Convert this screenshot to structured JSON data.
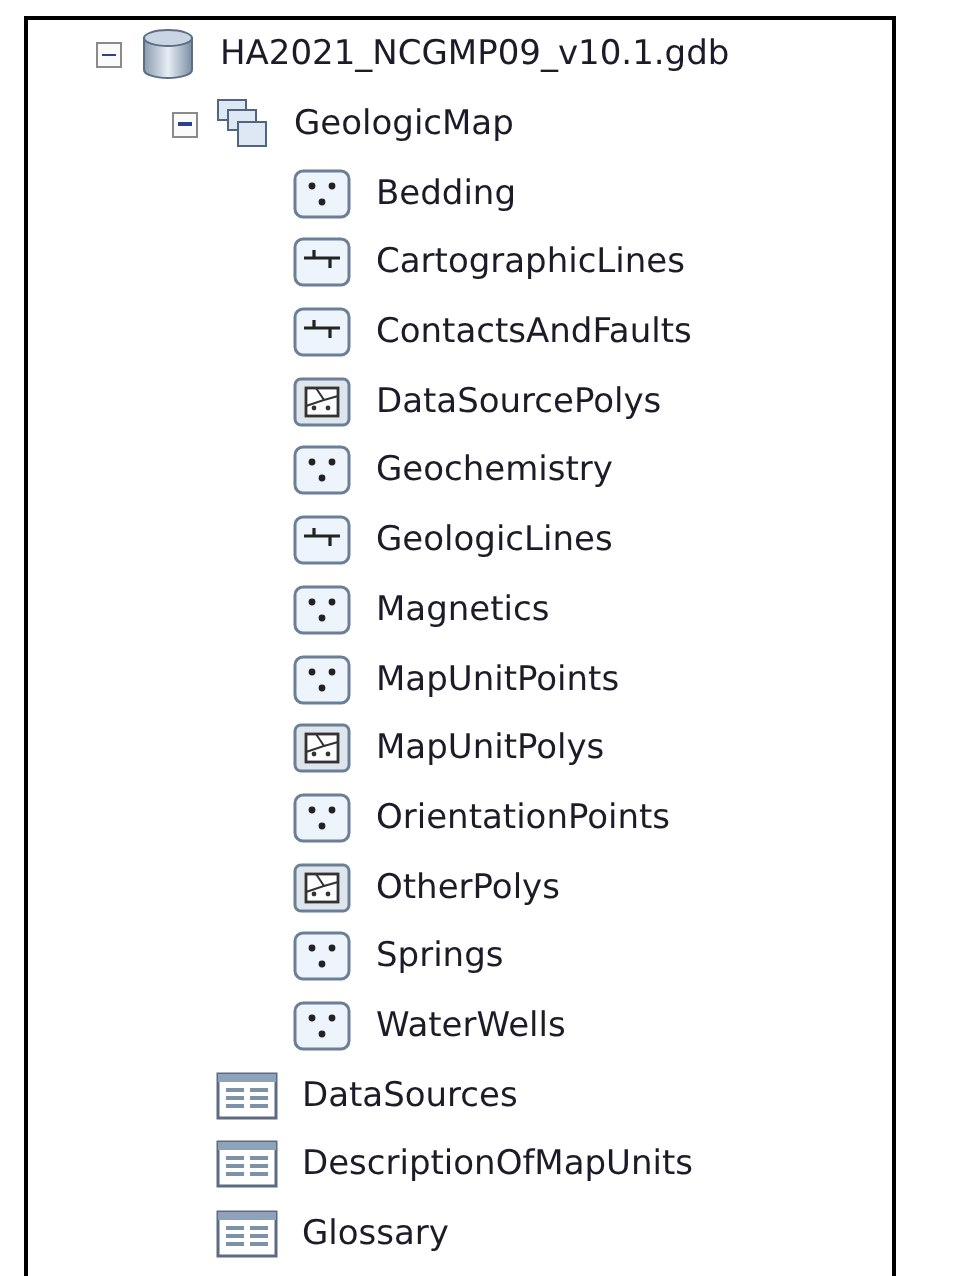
{
  "tree": [
    {
      "label": "HA2021_NCGMP09_v10.1.gdb",
      "kind": "database",
      "expanded": true,
      "children": [
        {
          "label": "GeologicMap",
          "kind": "dataset",
          "expanded": true,
          "children": [
            {
              "label": "Bedding",
              "kind": "point"
            },
            {
              "label": "CartographicLines",
              "kind": "line"
            },
            {
              "label": "ContactsAndFaults",
              "kind": "line"
            },
            {
              "label": "DataSourcePolys",
              "kind": "polygon"
            },
            {
              "label": "Geochemistry",
              "kind": "point"
            },
            {
              "label": "GeologicLines",
              "kind": "line"
            },
            {
              "label": "Magnetics",
              "kind": "point"
            },
            {
              "label": "MapUnitPoints",
              "kind": "point"
            },
            {
              "label": "MapUnitPolys",
              "kind": "polygon"
            },
            {
              "label": "OrientationPoints",
              "kind": "point"
            },
            {
              "label": "OtherPolys",
              "kind": "polygon"
            },
            {
              "label": "Springs",
              "kind": "point"
            },
            {
              "label": "WaterWells",
              "kind": "point"
            }
          ]
        },
        {
          "label": "DataSources",
          "kind": "table"
        },
        {
          "label": "DescriptionOfMapUnits",
          "kind": "table"
        },
        {
          "label": "Glossary",
          "kind": "table"
        }
      ]
    }
  ]
}
